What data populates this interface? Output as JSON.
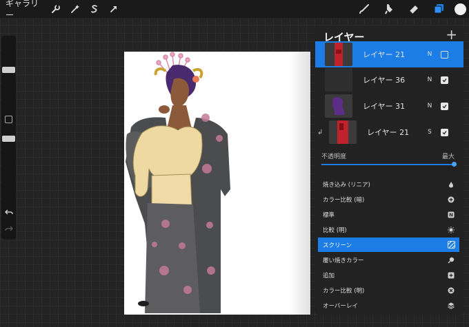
{
  "toolbar": {
    "gallery_label": "ギャラリー",
    "color_swatch": "#f1f1f1"
  },
  "layers_panel": {
    "title": "レイヤー",
    "add_symbol": "+",
    "layers": [
      {
        "name": "レイヤー 21",
        "blend": "N",
        "visible": false,
        "active": true
      },
      {
        "name": "レイヤー 36",
        "blend": "N",
        "visible": true,
        "active": false
      },
      {
        "name": "レイヤー 31",
        "blend": "N",
        "visible": true,
        "active": false
      },
      {
        "name": "レイヤー 21",
        "blend": "S",
        "visible": true,
        "active": false,
        "clipped": true
      }
    ],
    "opacity_label": "不透明度",
    "opacity_value_label": "最大",
    "opacity_fraction": 1.0,
    "blend_modes": [
      {
        "label": "焼き込み (リニア)",
        "icon": "flame-icon"
      },
      {
        "label": "カラー比較 (暗)",
        "icon": "plus-circle-icon"
      },
      {
        "label": "標準",
        "icon": "n-square-icon",
        "icon_text": "N"
      },
      {
        "label": "比較 (明)",
        "icon": "sun-icon"
      },
      {
        "label": "スクリーン",
        "icon": "hatch-icon",
        "active": true
      },
      {
        "label": "覆い焼きカラー",
        "icon": "magnifier-icon"
      },
      {
        "label": "追加",
        "icon": "plus-square-icon"
      },
      {
        "label": "カラー比較 (明)",
        "icon": "x-circle-icon"
      },
      {
        "label": "オーバーレイ",
        "icon": "layers-icon"
      }
    ]
  },
  "colors": {
    "accent": "#1c7de6",
    "panel_bg": "#222222",
    "topbar_bg": "#1a1a1a"
  }
}
